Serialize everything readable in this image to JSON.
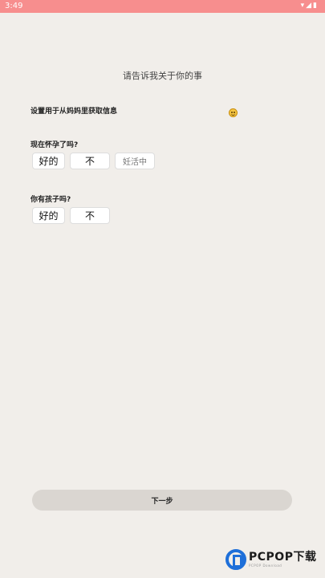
{
  "status_bar": {
    "time": "3:49",
    "icons": "▾◢▮"
  },
  "page": {
    "heading": "请告诉我关于你的事",
    "intro": "设置用于从妈妈里获取信息",
    "emoji": "smiley-face-icon"
  },
  "questions": [
    {
      "label": "现在怀孕了吗?",
      "options": [
        "好的",
        "不",
        "妊活中"
      ]
    },
    {
      "label": "你有孩子吗?",
      "options": [
        "好的",
        "不"
      ]
    }
  ],
  "next_button": {
    "label": "下一步"
  },
  "watermark": {
    "text": "PCPOP下载",
    "subtext": "PCPOP Download"
  },
  "colors": {
    "status_bar": "#f78e8e",
    "background": "#f1eeea",
    "button": "#dad6d1",
    "watermark_logo": "#1e6fd9"
  }
}
